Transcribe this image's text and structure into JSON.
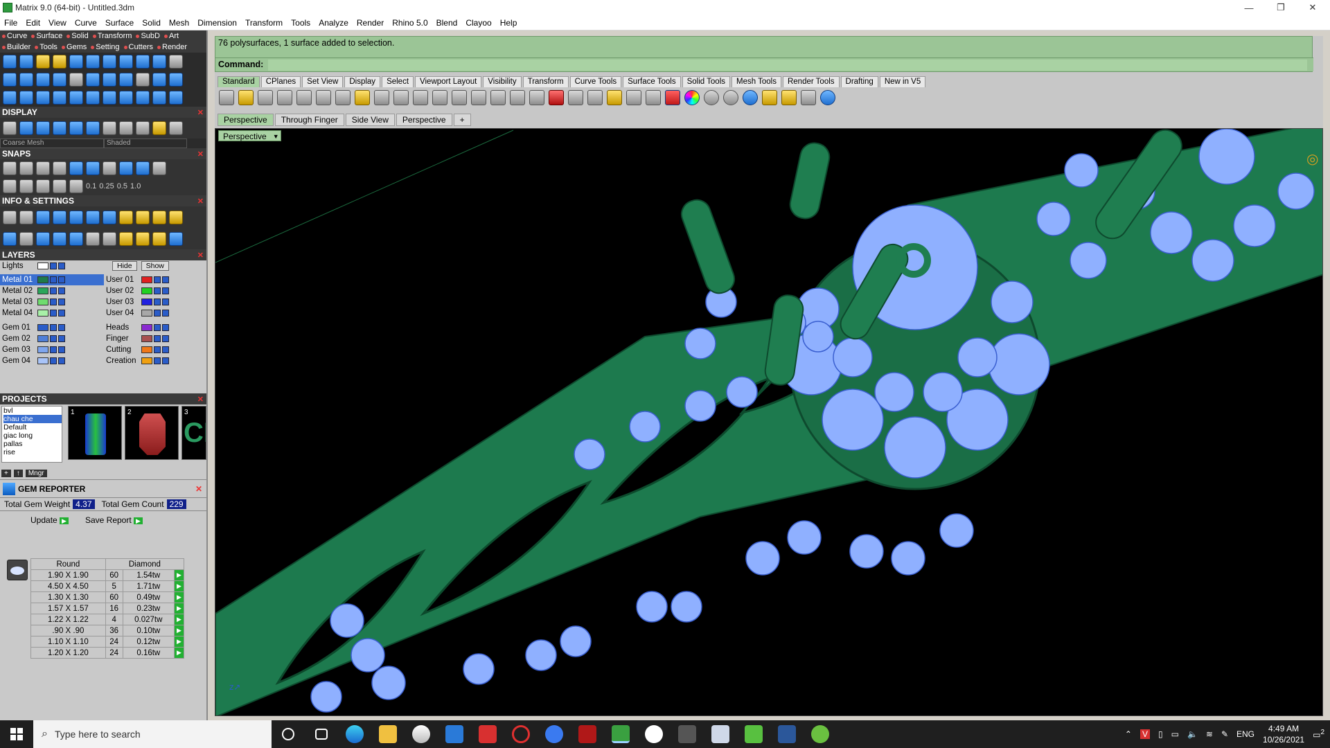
{
  "window": {
    "title": "Matrix 9.0 (64-bit) - Untitled.3dm",
    "minimize": "—",
    "restore": "❐",
    "close": "✕"
  },
  "menu": [
    "File",
    "Edit",
    "View",
    "Curve",
    "Surface",
    "Solid",
    "Mesh",
    "Dimension",
    "Transform",
    "Tools",
    "Analyze",
    "Render",
    "Rhino 5.0",
    "Blend",
    "Clayoo",
    "Help"
  ],
  "left_ribbon": {
    "row1": [
      "Curve",
      "Surface",
      "Solid",
      "Transform",
      "SubD",
      "Art"
    ],
    "row2": [
      "Builder",
      "Tools",
      "Gems",
      "Setting",
      "Cutters",
      "Render"
    ]
  },
  "display": {
    "title": "DISPLAY",
    "mesh_value": "Coarse Mesh",
    "mode_value": "Shaded"
  },
  "snaps": {
    "title": "SNAPS",
    "values": [
      "0.1",
      "0.25",
      "0.5",
      "1.0"
    ]
  },
  "info": {
    "title": "INFO & SETTINGS"
  },
  "layers": {
    "title": "LAYERS",
    "hide": "Hide",
    "show": "Show",
    "left": [
      {
        "name": "Lights",
        "color": "#ffffff"
      },
      {
        "name": "Metal 01",
        "color": "#1f7a4a"
      },
      {
        "name": "Metal 02",
        "color": "#2aa55a"
      },
      {
        "name": "Metal 03",
        "color": "#6fdc6f"
      },
      {
        "name": "Metal 04",
        "color": "#a8f0a8"
      },
      {
        "name": "Gem 01",
        "color": "#2a5cc8"
      },
      {
        "name": "Gem 02",
        "color": "#4f7fd8"
      },
      {
        "name": "Gem 03",
        "color": "#7fa6ee"
      },
      {
        "name": "Gem 04",
        "color": "#a9c4f8"
      }
    ],
    "right": [
      {
        "name": "User 01",
        "color": "#e02020"
      },
      {
        "name": "User 02",
        "color": "#20d020"
      },
      {
        "name": "User 03",
        "color": "#2020e0"
      },
      {
        "name": "User 04",
        "color": "#a8a8a8"
      },
      {
        "name": "Heads",
        "color": "#8a2ad0"
      },
      {
        "name": "Finger",
        "color": "#a85050"
      },
      {
        "name": "Cutting",
        "color": "#f07818"
      },
      {
        "name": "Creation",
        "color": "#f0a010"
      }
    ]
  },
  "projects": {
    "title": "PROJECTS",
    "items": [
      "bvl",
      "chau che",
      "Default",
      "giac long",
      "pallas",
      "rise"
    ],
    "thumbs": [
      "1",
      "2",
      "3"
    ],
    "mngr": "Mngr"
  },
  "gem_reporter": {
    "title": "GEM REPORTER",
    "weight_label": "Total Gem Weight",
    "weight_value": "4.37",
    "count_label": "Total Gem Count",
    "count_value": "229",
    "update": "Update",
    "save_report": "Save Report",
    "col_shape": "Round",
    "col_type": "Diamond",
    "rows": [
      {
        "size": "1.90 X 1.90",
        "count": "60",
        "tw": "1.54tw"
      },
      {
        "size": "4.50 X 4.50",
        "count": "5",
        "tw": "1.71tw"
      },
      {
        "size": "1.30 X 1.30",
        "count": "60",
        "tw": "0.49tw"
      },
      {
        "size": "1.57 X 1.57",
        "count": "16",
        "tw": "0.23tw"
      },
      {
        "size": "1.22 X 1.22",
        "count": "4",
        "tw": "0.027tw"
      },
      {
        "size": ".90 X .90",
        "count": "36",
        "tw": "0.10tw"
      },
      {
        "size": "1.10 X 1.10",
        "count": "24",
        "tw": "0.12tw"
      },
      {
        "size": "1.20 X 1.20",
        "count": "24",
        "tw": "0.16tw"
      }
    ]
  },
  "command": {
    "message": "76 polysurfaces, 1 surface added to selection.",
    "label": "Command:",
    "value": ""
  },
  "toolbar_tabs": [
    "Standard",
    "CPlanes",
    "Set View",
    "Display",
    "Select",
    "Viewport Layout",
    "Visibility",
    "Transform",
    "Curve Tools",
    "Surface Tools",
    "Solid Tools",
    "Mesh Tools",
    "Render Tools",
    "Drafting",
    "New in V5"
  ],
  "viewport_tabs": [
    "Perspective",
    "Through Finger",
    "Side View",
    "Perspective"
  ],
  "viewport_label": "Perspective",
  "taskbar": {
    "search_placeholder": "Type here to search",
    "lang": "ENG",
    "time": "4:49 AM",
    "date": "10/26/2021",
    "notif": "2"
  }
}
